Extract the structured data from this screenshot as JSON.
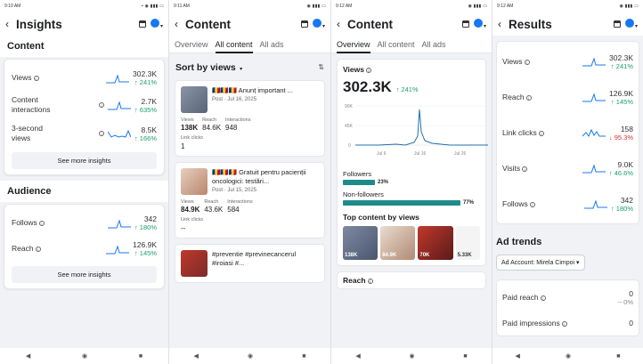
{
  "screens": {
    "insights": {
      "time": "9:10 AM",
      "title": "Insights",
      "content_heading": "Content",
      "metrics": [
        {
          "label": "Views",
          "value": "302.3K",
          "change": "↑ 241%"
        },
        {
          "label": "Content interactions",
          "value": "2.7K",
          "change": "↑ 635%"
        },
        {
          "label": "3-second views",
          "value": "8.5K",
          "change": "↑ 166%"
        }
      ],
      "see_more": "See more insights",
      "audience_heading": "Audience",
      "audience": [
        {
          "label": "Follows",
          "value": "342",
          "change": "↑ 180%"
        },
        {
          "label": "Reach",
          "value": "126.9K",
          "change": "↑ 145%"
        }
      ],
      "see_more_2": "See more insights"
    },
    "content_all": {
      "time": "9:11 AM",
      "title": "Content",
      "tabs": [
        "Overview",
        "All content",
        "All ads"
      ],
      "sort": "Sort by views",
      "posts": [
        {
          "text": "🇷🇴🇷🇴🇷🇴 Anunț important ...",
          "date": "Post · Jul 16, 2025",
          "views": "138K",
          "reach": "84.6K",
          "interactions": "948",
          "link_clicks": "1"
        },
        {
          "text": "🇷🇴🇷🇴🇷🇴 Gratuit pentru pacienții oncologici: testări...",
          "date": "Post · Jul 15, 2025",
          "views": "84.9K",
          "reach": "43.6K",
          "interactions": "584",
          "link_clicks": "--"
        },
        {
          "text": "#preventie #previnecancerul #iroiasi #...",
          "date": "",
          "views": "",
          "reach": "",
          "interactions": "",
          "link_clicks": ""
        }
      ],
      "col_views": "Views",
      "col_reach": "Reach",
      "col_interactions": "Interactions",
      "col_link_clicks": "Link clicks"
    },
    "content_overview": {
      "time": "9:12 AM",
      "title": "Content",
      "tabs": [
        "Overview",
        "All content",
        "All ads"
      ],
      "views_label": "Views",
      "views_value": "302.3K",
      "views_change": "↑ 241%",
      "y_ticks": [
        "90K",
        "45K",
        "0"
      ],
      "x_ticks": [
        "Jul 6",
        "Jul 16",
        "Jul 26"
      ],
      "followers_label": "Followers",
      "followers_pct": "23%",
      "nonfollowers_label": "Non-followers",
      "nonfollowers_pct": "77%",
      "top_content": "Top content by views",
      "thumbs": [
        "138K",
        "84.9K",
        "70K",
        "5.33K"
      ],
      "reach_label": "Reach"
    },
    "results": {
      "time": "9:12 AM",
      "title": "Results",
      "metrics": [
        {
          "label": "Views",
          "value": "302.3K",
          "change": "↑ 241%"
        },
        {
          "label": "Reach",
          "value": "126.9K",
          "change": "↑ 145%"
        },
        {
          "label": "Link clicks",
          "value": "158",
          "change": "↓ 95.3%"
        },
        {
          "label": "Visits",
          "value": "9.0K",
          "change": "↑ 46.6%"
        },
        {
          "label": "Follows",
          "value": "342",
          "change": "↑ 180%"
        }
      ],
      "ad_trends": "Ad trends",
      "account": "Ad Account: Mirela Cimpoi",
      "ad_metrics": [
        {
          "label": "Paid reach",
          "value": "0",
          "change": "-- 0%"
        },
        {
          "label": "Paid impressions",
          "value": "0",
          "change": ""
        }
      ]
    }
  },
  "colors": {
    "accent": "#1877f2",
    "positive": "#1a9e6a",
    "negative": "#d0323a",
    "bar": "#1f8a8a"
  }
}
